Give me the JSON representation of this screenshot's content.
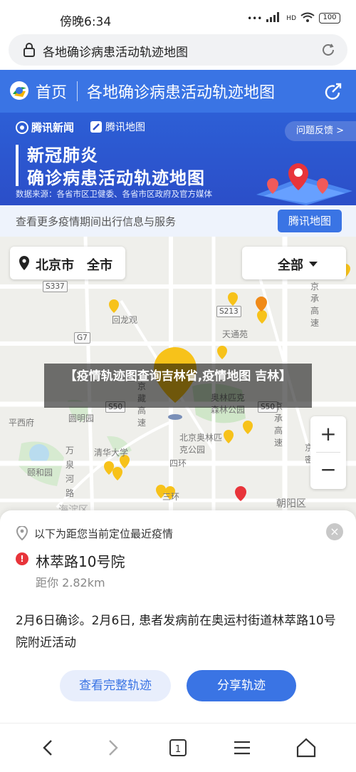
{
  "status_bar": {
    "time": "傍晚6:34",
    "battery": "100",
    "signal": "HD"
  },
  "address_bar": {
    "title": "各地确诊病患活动轨迹地图"
  },
  "header": {
    "home_label": "首页",
    "title": "各地确诊病患活动轨迹地图"
  },
  "banner": {
    "brand_news": "腾讯新闻",
    "brand_map": "腾讯地图",
    "feedback": "问题反馈 >",
    "title_line1": "新冠肺炎",
    "title_line2": "确诊病患活动轨迹地图",
    "source": "数据来源：各省市区卫健委、各省市区政府及官方媒体"
  },
  "info_row": {
    "text": "查看更多疫情期间出行信息与服务",
    "button": "腾讯地图"
  },
  "map": {
    "city": "北京市",
    "scope": "全市",
    "filter": "全部",
    "zoom_in": "+",
    "zoom_out": "−",
    "labels": {
      "huilongguan": "回龙观",
      "tianTongyuan": "天通苑",
      "pingxishu": "平西府",
      "yuanmingyuan": "圆明园",
      "qinghua": "清华大学",
      "yiheyuan": "颐和园",
      "wanquanhe": "万泉河路",
      "olympic": "北京奥林匹克公园",
      "sihuan": "四环",
      "sanhuan": "三环",
      "chaoyang": "朝阳区",
      "haidian": "海淀区",
      "jingcheng": "京承高速",
      "jingzang": "京藏高速",
      "senlin": "奥林匹克森林公园",
      "jingmi": "京密"
    },
    "shields": {
      "s337": "S337",
      "s213": "S213",
      "g7": "G7",
      "s50a": "S50",
      "s50b": "S50"
    }
  },
  "caption": "【疫情轨迹图查询吉林省,疫情地图 吉林】",
  "card": {
    "nearest_label": "以下为距您当前定位最近疫情",
    "place": "林萃路10号院",
    "distance": "距你 2.82km",
    "description": "2月6日确诊。2月6日, 患者发病前在奥运村街道林萃路10号院附近活动",
    "btn_track": "查看完整轨迹",
    "btn_share": "分享轨迹"
  },
  "colors": {
    "brand_blue": "#3a74e4",
    "pin_yellow": "#f7c21a",
    "pin_orange": "#f08a18",
    "pin_red": "#e8343a"
  }
}
